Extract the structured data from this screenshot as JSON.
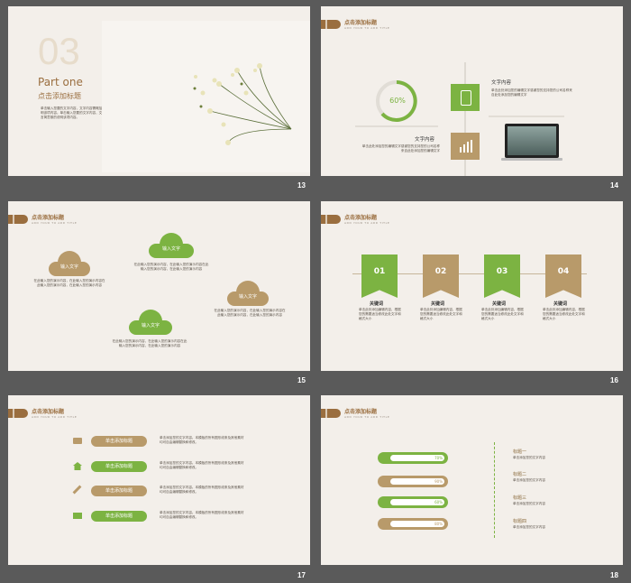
{
  "slides": {
    "s13": {
      "number": "13",
      "big_number": "03",
      "part": "Part one",
      "subtitle": "点击添加标题",
      "body": "单击输入您要的文字内容，文字内容需概括精炼，不用多余的文字修饰，言简意赅的说明该项内容。单击输入您要的文字内容，文字内容需概括精炼，不用多余的文字修饰，言简意赅的说明该项内容。"
    },
    "s14": {
      "number": "14",
      "header_title": "点击添加标题",
      "header_sub": "ADD YOUR TO ADD TITLE",
      "gauge": "60%",
      "left_title": "文字内容",
      "left_body": "单击此处添加您的编辑文字感谢您的支持您的公司名称来自此处添加您的编辑文字",
      "right_title": "文字内容",
      "right_body": "单击此处添加您的编辑文字感谢您的支持您的公司名称来自此处添加您的编辑文字"
    },
    "s15": {
      "number": "15",
      "header_title": "点击添加标题",
      "header_sub": "ADD YOUR TO ADD TITLE",
      "clouds": [
        {
          "label": "输入文字",
          "text": "在此输入您的演示内容，在此输入您的演示内容在此输入您的演示内容，在此输入您的演示内容"
        },
        {
          "label": "输入文字",
          "text": "在此输入您的演示内容，在此输入您的演示内容在此输入您的演示内容，在此输入您的演示内容"
        },
        {
          "label": "输入文字",
          "text": "在此输入您的演示内容，在此输入您的演示内容在此输入您的演示内容，在此输入您的演示内容"
        },
        {
          "label": "输入文字",
          "text": "在此输入您的演示内容，在此输入您的演示内容在此输入您的演示内容，在此输入您的演示内容"
        }
      ]
    },
    "s16": {
      "number": "16",
      "header_title": "点击添加标题",
      "header_sub": "ADD YOUR TO ADD TITLE",
      "steps": [
        {
          "num": "01",
          "title": "关键词",
          "text": "单击此处添加编辑内容，根据您的需要适当修改此处文字和格式大小"
        },
        {
          "num": "02",
          "title": "关键词",
          "text": "单击此处添加编辑内容，根据您的需要适当修改此处文字和格式大小"
        },
        {
          "num": "03",
          "title": "关键词",
          "text": "单击此处添加编辑内容，根据您的需要适当修改此处文字和格式大小"
        },
        {
          "num": "04",
          "title": "关键词",
          "text": "单击此处添加编辑内容，根据您的需要适当修改此处文字和格式大小"
        }
      ]
    },
    "s17": {
      "number": "17",
      "header_title": "点击添加标题",
      "header_sub": "ADD YOUR TO ADD TITLE",
      "rows": [
        {
          "label": "单击添加标题",
          "text": "单击添加您的文字内容。本模板的所有图形线条及其他素材均可自由编辑替换和修改。"
        },
        {
          "label": "单击添加标题",
          "text": "单击添加您的文字内容。本模板的所有图形线条及其他素材均可自由编辑替换和修改。"
        },
        {
          "label": "单击添加标题",
          "text": "单击添加您的文字内容。本模板的所有图形线条及其他素材均可自由编辑替换和修改。"
        },
        {
          "label": "单击添加标题",
          "text": "单击添加您的文字内容。本模板的所有图形线条及其他素材均可自由编辑替换和修改。"
        }
      ]
    },
    "s18": {
      "number": "18",
      "header_title": "点击添加标题",
      "header_sub": "ADD YOUR TO ADD TITLE",
      "bars": [
        {
          "pct": "70%",
          "value": 0.7
        },
        {
          "pct": "90%",
          "value": 0.9
        },
        {
          "pct": "60%",
          "value": 0.6
        },
        {
          "pct": "80%",
          "value": 0.8
        }
      ],
      "legend": [
        {
          "title": "标题一",
          "text": "单击添加您的文字内容"
        },
        {
          "title": "标题二",
          "text": "单击添加您的文字内容"
        },
        {
          "title": "标题三",
          "text": "单击添加您的文字内容"
        },
        {
          "title": "标题四",
          "text": "单击添加您的文字内容"
        }
      ]
    }
  },
  "colors": {
    "green": "#7cb342",
    "tan": "#b89a6a",
    "brown": "#9a6e3f",
    "bg": "#f3efea"
  }
}
